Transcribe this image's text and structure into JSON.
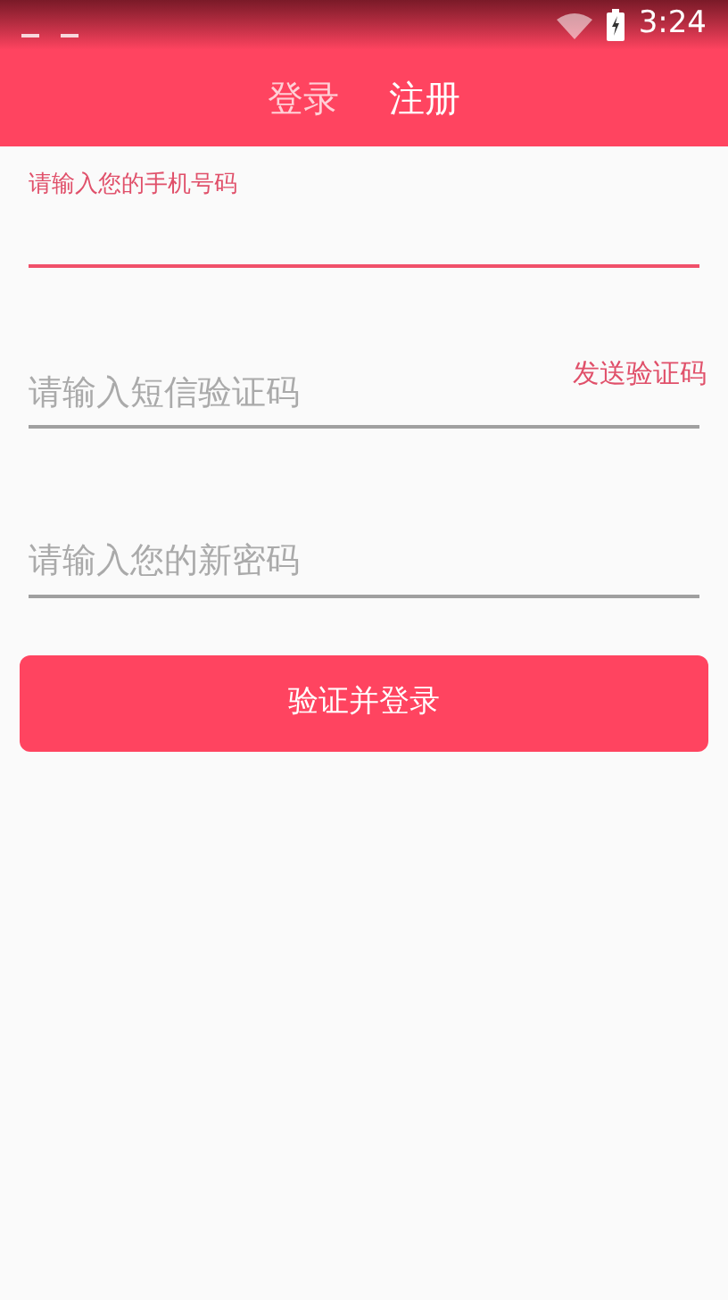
{
  "status_bar": {
    "time": "3:24"
  },
  "tabs": [
    {
      "label": "登录",
      "selected": false
    },
    {
      "label": "注册",
      "selected": true
    }
  ],
  "fields": [
    {
      "placeholder": "请输入您的手机号码",
      "focused": true
    },
    {
      "placeholder": "请输入短信验证码",
      "focused": false,
      "action": "发送验证码"
    },
    {
      "placeholder": "请输入您的新密码",
      "focused": false
    }
  ],
  "submit": "验证并登录"
}
